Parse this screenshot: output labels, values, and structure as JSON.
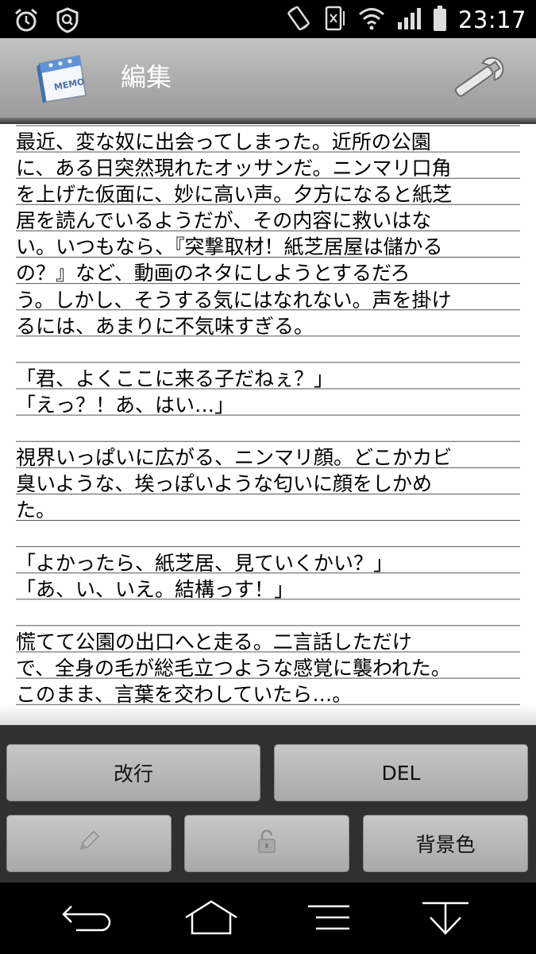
{
  "status_bar": {
    "time": "23:17",
    "icons": [
      "alarm-icon",
      "shield-icon",
      "rotate-icon",
      "vibrate-icon",
      "wifi-icon",
      "signal-icon",
      "battery-icon"
    ]
  },
  "action_bar": {
    "app_icon": "memo-calendar-icon",
    "title": "編集",
    "settings_icon": "wrench-icon"
  },
  "editor": {
    "text": "最近、変な奴に出会ってしまった。近所の公園\nに、ある日突然現れたオッサンだ。ニンマリ口角\nを上げた仮面に、妙に高い声。夕方になると紙芝\n居を読んでいるようだが、その内容に救いはな\nい。いつもなら、『突撃取材！紙芝居屋は儲かる\nの？』など、動画のネタにしようとするだろ\nう。しかし、そうする気にはなれない。声を掛け\nるには、あまりに不気味すぎる。\n\n「君、よくここに来る子だねぇ？」\n「えっ？！あ、はい…」\n\n視界いっぱいに広がる、ニンマリ顔。どこかカビ\n臭いような、埃っぽいような匂いに顔をしかめ\nた。\n\n「よかったら、紙芝居、見ていくかい？」\n「あ、い、いえ。結構っす！」\n\n慌てて公園の出口へと走る。二言話しただけ\nで、全身の毛が総毛立つような感覚に襲われた。\nこのまま、言葉を交わしていたら…。"
  },
  "buttons": {
    "newline": "改行",
    "delete": "DEL",
    "pencil_icon": "pencil-icon",
    "lock_icon": "lock-icon",
    "background_color": "背景色"
  },
  "nav_bar": {
    "icons": [
      "back-icon",
      "home-icon",
      "menu-icon",
      "hide-keyboard-icon"
    ]
  }
}
